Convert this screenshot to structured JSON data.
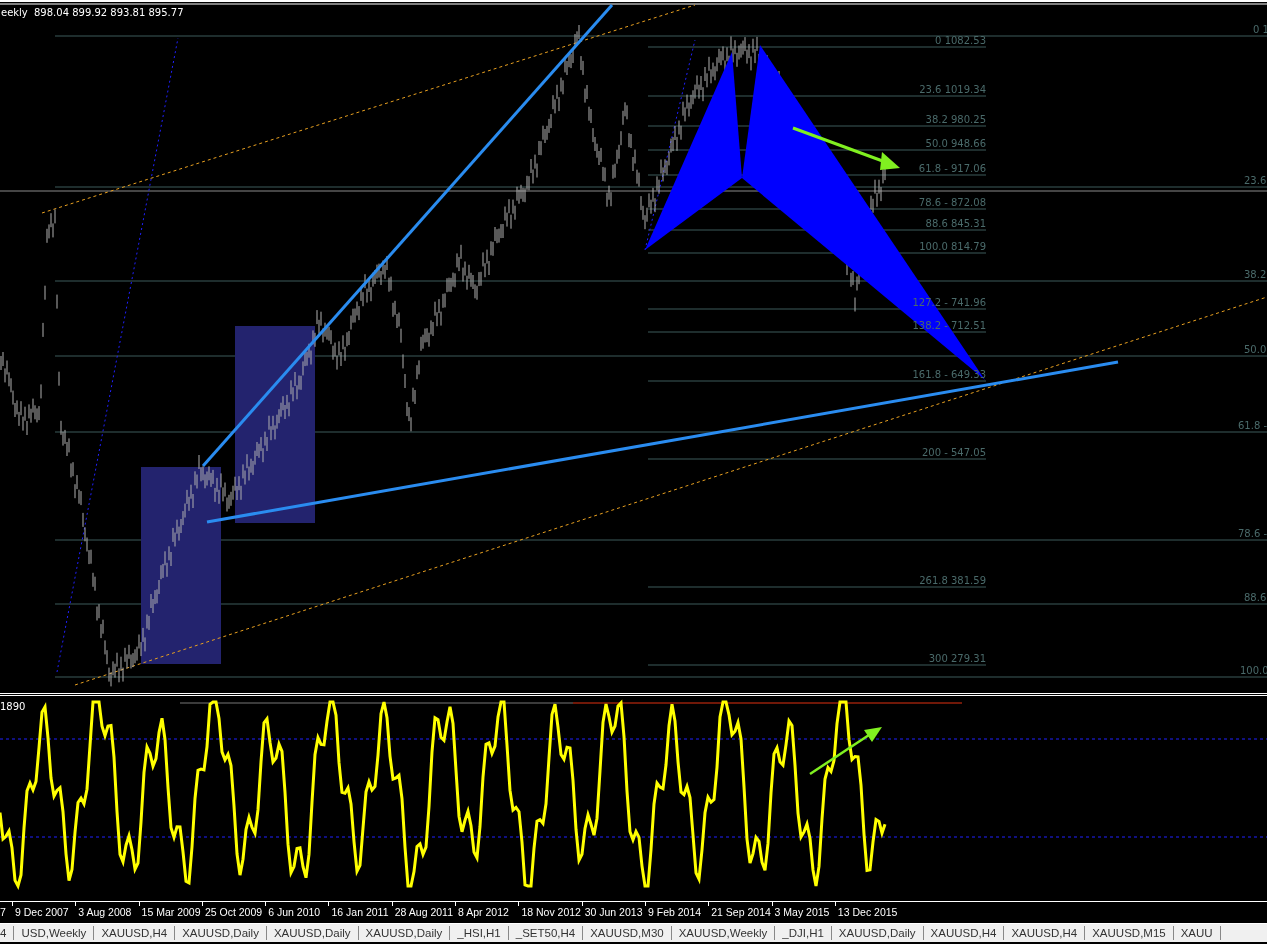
{
  "chart": {
    "symbol": "eekly",
    "ohlc": "898.04 899.92 893.81 895.77",
    "fib_levels": [
      {
        "label": "0 1082.53"
      },
      {
        "label": "23.6 1019.34"
      },
      {
        "label": "38.2 980.25"
      },
      {
        "label": "50.0 948.66"
      },
      {
        "label": "61.8 - 917.06"
      },
      {
        "label": "78.6 - 872.08"
      },
      {
        "label": "88.6 845.31"
      },
      {
        "label": "100.0 814.79"
      },
      {
        "label": "127.2 - 741.96"
      },
      {
        "label": "138.2 - 712.51"
      },
      {
        "label": "161.8 -  649.33"
      },
      {
        "label": "200 - 547.05"
      },
      {
        "label": "261.8 381.59"
      },
      {
        "label": "300 279.31"
      }
    ],
    "right_levels": [
      {
        "label": "0 1"
      },
      {
        "label": "23.6"
      },
      {
        "label": "38.2"
      },
      {
        "label": "50.0"
      },
      {
        "label": "61.8 -"
      },
      {
        "label": "78.6 -"
      },
      {
        "label": "88.6"
      },
      {
        "label": "100.0"
      }
    ]
  },
  "indicator": {
    "label": "1890"
  },
  "time_axis": {
    "labels": [
      "7",
      "9 Dec 2007",
      "3 Aug 2008",
      "15 Mar 2009",
      "25 Oct 2009",
      "6 Jun 2010",
      "16 Jan 2011",
      "28 Aug 2011",
      "8 Apr 2012",
      "18 Nov 2012",
      "30 Jun 2013",
      "9 Feb 2014",
      "21 Sep 2014",
      "3 May 2015",
      "13 Dec 2015"
    ]
  },
  "tabs": [
    {
      "label": "4"
    },
    {
      "label": "USD,Weekly"
    },
    {
      "label": "XAUUSD,H4"
    },
    {
      "label": "XAUUSD,Daily"
    },
    {
      "label": "XAUUSD,Daily"
    },
    {
      "label": "XAUUSD,Daily"
    },
    {
      "label": "_HSI,H1"
    },
    {
      "label": "_SET50,H4"
    },
    {
      "label": "XAUUSD,M30"
    },
    {
      "label": "XAUUSD,Weekly"
    },
    {
      "label": "_DJI,H1"
    },
    {
      "label": "XAUUSD,Daily"
    },
    {
      "label": "XAUUSD,H4"
    },
    {
      "label": "XAUUSD,H4"
    },
    {
      "label": "XAUUSD,M15"
    },
    {
      "label": "XAUU"
    }
  ]
}
